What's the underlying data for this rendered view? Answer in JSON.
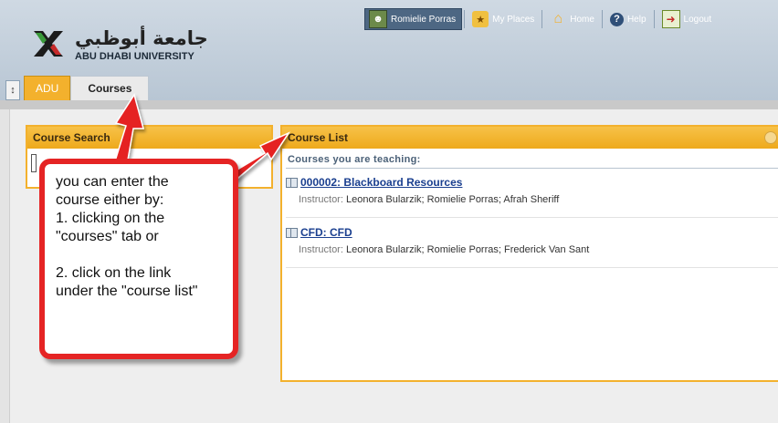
{
  "header": {
    "logo_arabic": "جامعة أبوظبي",
    "logo_english": "ABU DHABI UNIVERSITY"
  },
  "topnav": {
    "user": "Romielie Porras",
    "my_places": "My Places",
    "home": "Home",
    "help": "Help",
    "logout": "Logout"
  },
  "tabs": [
    {
      "label": "ADU"
    },
    {
      "label": "Courses"
    }
  ],
  "course_search": {
    "title": "Course Search"
  },
  "course_list": {
    "title": "Course List",
    "subtitle": "Courses you are teaching:",
    "courses": [
      {
        "title": "000002: Blackboard Resources",
        "instructor_label": "Instructor:",
        "instructors": "Leonora Bularzik;  Romielie Porras;  Afrah Sheriff"
      },
      {
        "title": "CFD: CFD",
        "instructor_label": "Instructor:",
        "instructors": "Leonora Bularzik;  Romielie Porras;  Frederick Van Sant"
      }
    ]
  },
  "callout": {
    "line1": "you can enter the",
    "line2": "course either by:",
    "line3": "1. clicking on the",
    "line4": "\"courses\" tab or",
    "line5": "2. click on the link",
    "line6": "under the \"course list\""
  },
  "colors": {
    "accent": "#f3b12d",
    "header": "#c4d0dc",
    "callout_border": "#e52424",
    "link": "#1a3f8f"
  }
}
